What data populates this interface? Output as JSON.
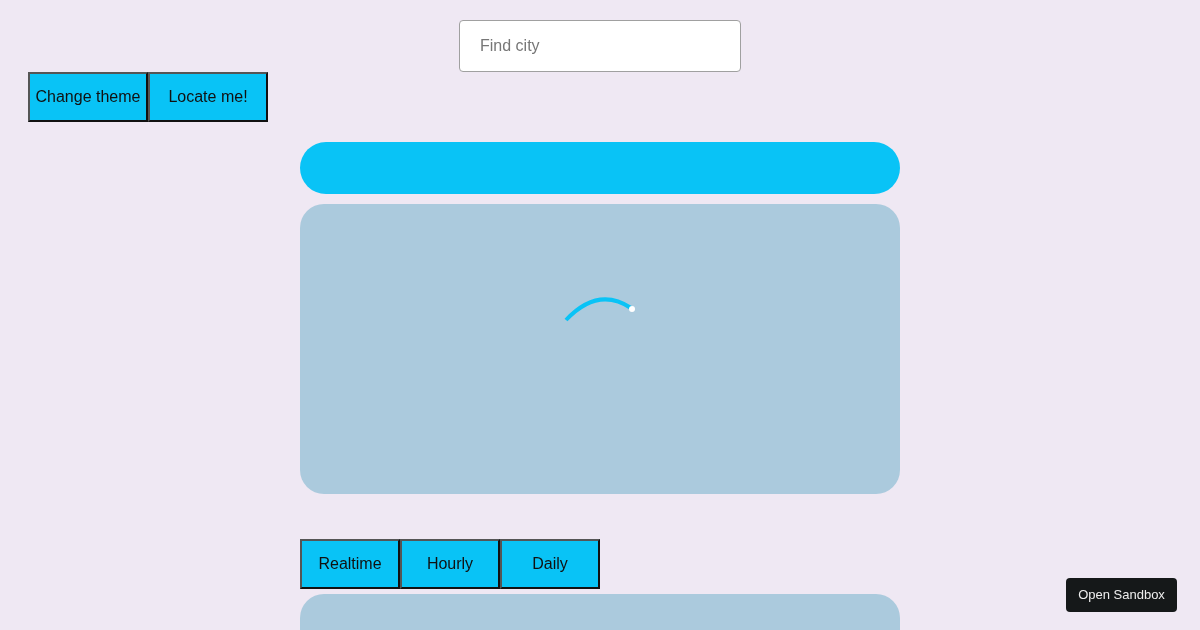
{
  "search": {
    "placeholder": "Find city"
  },
  "actions": [
    "Change theme",
    "Locate me!"
  ],
  "loading": true,
  "tabs": [
    "Realtime",
    "Hourly",
    "Daily"
  ],
  "sandbox_button": "Open Sandbox"
}
